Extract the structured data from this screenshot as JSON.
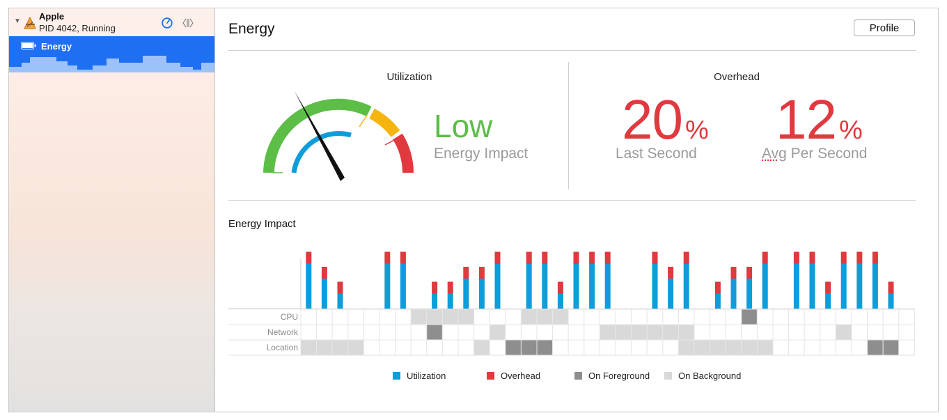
{
  "sidebar": {
    "process": {
      "name": "Apple",
      "detail": "PID 4042, Running"
    },
    "gauges": [
      {
        "label": "Energy",
        "icon": "battery-icon",
        "selected": true
      }
    ]
  },
  "main": {
    "title": "Energy",
    "profile_button": "Profile",
    "utilization": {
      "title": "Utilization",
      "level": "Low",
      "caption": "Energy Impact"
    },
    "overhead": {
      "title": "Overhead",
      "unit": "%",
      "last_second": {
        "value": "20",
        "label": "Last Second"
      },
      "avg_per_second": {
        "value": "12",
        "label_avg": "Avg",
        "label_rest": " Per Second"
      }
    },
    "energy_impact": {
      "title": "Energy Impact"
    }
  },
  "colors": {
    "utilization": "#0d9ddb",
    "overhead": "#e0393e",
    "foreground": "#8e8e8e",
    "background": "#d9d9d9",
    "low": "#5cbd47",
    "selection": "#1e6ff1"
  },
  "chart_data": {
    "type": "bar",
    "title": "Energy Impact",
    "rows": [
      "CPU",
      "Network",
      "Location"
    ],
    "bars": [
      {
        "u": 3,
        "o": 1
      },
      {
        "u": 2,
        "o": 1
      },
      {
        "u": 1,
        "o": 1
      },
      {
        "u": 0,
        "o": 0
      },
      {
        "u": 0,
        "o": 0
      },
      {
        "u": 3,
        "o": 1
      },
      {
        "u": 3,
        "o": 1
      },
      {
        "u": 0,
        "o": 0
      },
      {
        "u": 1,
        "o": 1
      },
      {
        "u": 1,
        "o": 1
      },
      {
        "u": 2,
        "o": 1
      },
      {
        "u": 2,
        "o": 1
      },
      {
        "u": 3,
        "o": 1
      },
      {
        "u": 0,
        "o": 0
      },
      {
        "u": 3,
        "o": 1
      },
      {
        "u": 3,
        "o": 1
      },
      {
        "u": 1,
        "o": 1
      },
      {
        "u": 3,
        "o": 1
      },
      {
        "u": 3,
        "o": 1
      },
      {
        "u": 3,
        "o": 1
      },
      {
        "u": 0,
        "o": 0
      },
      {
        "u": 0,
        "o": 0
      },
      {
        "u": 3,
        "o": 1
      },
      {
        "u": 2,
        "o": 1
      },
      {
        "u": 3,
        "o": 1
      },
      {
        "u": 0,
        "o": 0
      },
      {
        "u": 1,
        "o": 1
      },
      {
        "u": 2,
        "o": 1
      },
      {
        "u": 2,
        "o": 1
      },
      {
        "u": 3,
        "o": 1
      },
      {
        "u": 0,
        "o": 0
      },
      {
        "u": 3,
        "o": 1
      },
      {
        "u": 3,
        "o": 1
      },
      {
        "u": 1,
        "o": 1
      },
      {
        "u": 3,
        "o": 1
      },
      {
        "u": 3,
        "o": 1
      },
      {
        "u": 3,
        "o": 1
      },
      {
        "u": 1,
        "o": 1
      },
      {
        "u": 0,
        "o": 0
      }
    ],
    "activity": {
      "CPU": [
        0,
        0,
        0,
        0,
        0,
        0,
        0,
        1,
        1,
        1,
        1,
        0,
        0,
        0,
        1,
        1,
        1,
        0,
        0,
        0,
        0,
        0,
        0,
        0,
        0,
        0,
        0,
        0,
        2,
        0,
        0,
        0,
        0,
        0,
        0,
        0,
        0,
        0,
        0
      ],
      "Network": [
        0,
        0,
        0,
        0,
        0,
        0,
        0,
        0,
        2,
        0,
        0,
        0,
        1,
        0,
        0,
        0,
        0,
        0,
        0,
        1,
        1,
        1,
        1,
        1,
        1,
        0,
        0,
        0,
        0,
        0,
        0,
        0,
        0,
        0,
        1,
        0,
        0,
        0,
        0
      ],
      "Location": [
        1,
        1,
        1,
        1,
        0,
        0,
        0,
        0,
        0,
        0,
        0,
        1,
        0,
        2,
        2,
        2,
        0,
        0,
        0,
        0,
        0,
        0,
        0,
        0,
        1,
        1,
        1,
        1,
        1,
        1,
        0,
        0,
        0,
        0,
        0,
        0,
        2,
        2,
        0
      ]
    },
    "legend": [
      "Utilization",
      "Overhead",
      "On Foreground",
      "On Background"
    ]
  }
}
